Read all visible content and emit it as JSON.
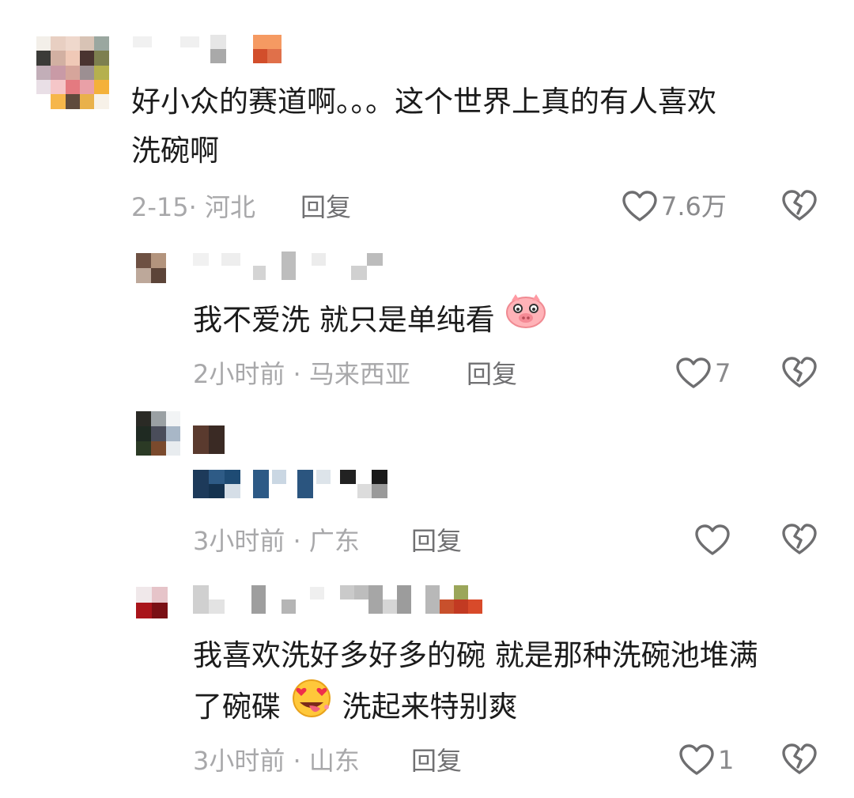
{
  "comments": [
    {
      "text_lines": [
        "好小众的赛道啊。。。这个世界上真的有人喜欢",
        "洗碗啊"
      ],
      "time_location": "2-15· 河北",
      "reply_label": "回复",
      "likes": "7.6万",
      "icons": {
        "like": "heart-outline-icon",
        "dislike": "broken-heart-icon"
      }
    },
    {
      "text": "我不爱洗 就只是单纯看",
      "emoji": "pig-face-emoji",
      "time_location": "2小时前 · 马来西亚",
      "reply_label": "回复",
      "likes": "7",
      "icons": {
        "like": "heart-outline-icon",
        "dislike": "broken-heart-icon"
      }
    },
    {
      "time_location": "3小时前 · 广东",
      "reply_label": "回复",
      "likes": "",
      "icons": {
        "like": "heart-outline-icon",
        "dislike": "broken-heart-icon"
      }
    },
    {
      "text_line1": "我喜欢洗好多好多的碗 就是那种洗碗池堆满",
      "text_line2_part1": "了碗碟",
      "emoji": "heart-eyes-tongue-emoji",
      "text_line2_part2": "洗起来特别爽",
      "time_location": "3小时前 · 山东",
      "reply_label": "回复",
      "likes": "1",
      "icons": {
        "like": "heart-outline-icon",
        "dislike": "broken-heart-icon"
      }
    }
  ],
  "colors": {
    "text": "#1b1b1b",
    "meta": "#a8a8aa",
    "reply": "#707072",
    "icon": "#6e6e70",
    "background": "#ffffff"
  }
}
